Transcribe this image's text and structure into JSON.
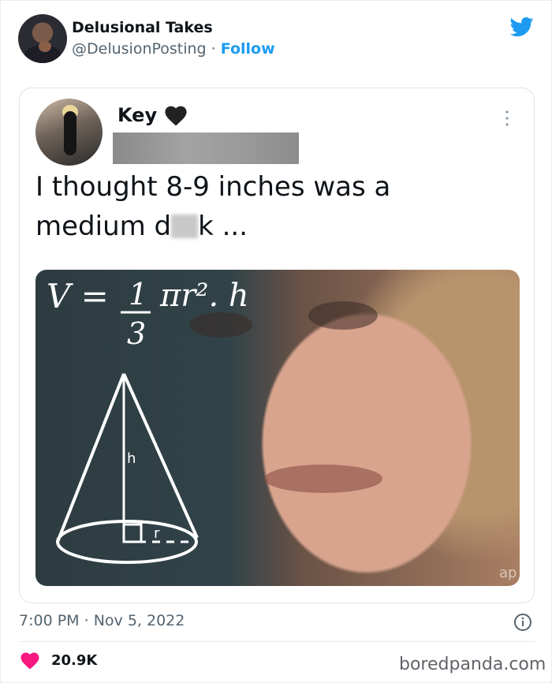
{
  "author": {
    "display_name": "Delusional Takes",
    "handle": "@DelusionPosting",
    "separator": "·",
    "follow_label": "Follow"
  },
  "quoted_tweet": {
    "name": "Key",
    "name_emoji": "black-heart-icon",
    "text_line1": "I thought 8-9 inches was a",
    "text_line2_prefix": "medium d",
    "text_line2_suffix": "k ...",
    "image": {
      "description_icon": "meme-image",
      "formula_v": "V = ",
      "formula_num": "1",
      "formula_den": "3",
      "formula_rest": "πr². h",
      "label_h": "h",
      "label_r": "r",
      "corner_text": "ap"
    }
  },
  "footer": {
    "time": "7:00 PM",
    "dot": "·",
    "date": "Nov 5, 2022",
    "likes": "20.9K"
  },
  "watermark": "boredpanda.com",
  "colors": {
    "twitter_blue": "#1d9bf0",
    "like_pink": "#f91880",
    "secondary_text": "#536471"
  }
}
